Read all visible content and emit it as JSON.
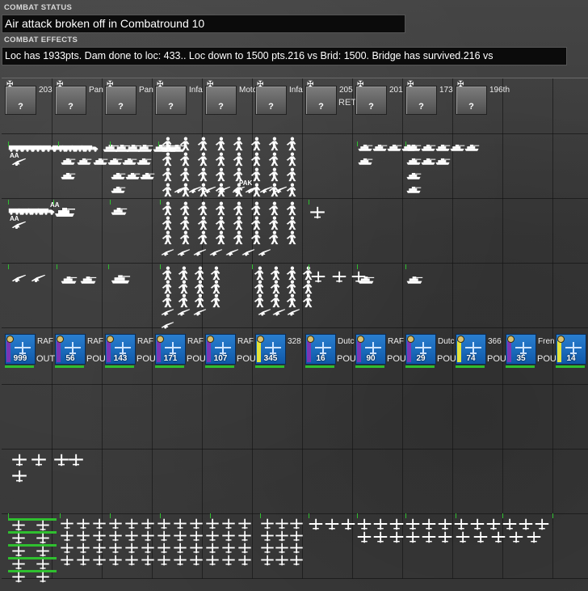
{
  "combat_status": {
    "label": "COMBAT STATUS",
    "text": "Air attack broken off in Combatround  10"
  },
  "combat_effects": {
    "label": "COMBAT EFFECTS",
    "text": "Loc has  1933pts. Dam done to loc: 433.. Loc down to 1500 pts.216 vs Brid: 1500. Bridge has survived.216 vs"
  },
  "defender_units": [
    {
      "name": "203",
      "value": "?"
    },
    {
      "name": "Pan",
      "value": "?"
    },
    {
      "name": "Pan",
      "value": "?"
    },
    {
      "name": "Infa",
      "value": "?"
    },
    {
      "name": "Moto",
      "value": "?"
    },
    {
      "name": "Infa",
      "value": "?"
    },
    {
      "name": "205",
      "value": "?",
      "status": "RET"
    },
    {
      "name": "201",
      "value": "?"
    },
    {
      "name": "173",
      "value": "?"
    },
    {
      "name": "196th",
      "value": "?"
    }
  ],
  "air_units": [
    {
      "name": "RAF",
      "value": "999",
      "status": "OUT",
      "stripe": "purple"
    },
    {
      "name": "RAF",
      "value": "56",
      "status": "POU",
      "stripe": "purple"
    },
    {
      "name": "RAF",
      "value": "143",
      "status": "POU",
      "stripe": "purple"
    },
    {
      "name": "RAF",
      "value": "171",
      "status": "POU",
      "stripe": "purple"
    },
    {
      "name": "RAF",
      "value": "107",
      "status": "POU",
      "stripe": "purple"
    },
    {
      "name": "328",
      "value": "345",
      "status": "",
      "stripe": "yellow"
    },
    {
      "name": "Dutc",
      "value": "16",
      "status": "POU",
      "stripe": "purple"
    },
    {
      "name": "RAF",
      "value": "90",
      "status": "POU",
      "stripe": "purple"
    },
    {
      "name": "Dutc",
      "value": "29",
      "status": "POU",
      "stripe": "purple"
    },
    {
      "name": "366",
      "value": "74",
      "status": "POU",
      "stripe": "yellow"
    },
    {
      "name": "Fren",
      "value": "35",
      "status": "POU",
      "stripe": "purple"
    },
    {
      "name": "",
      "value": "14",
      "status": "",
      "stripe": "yellow"
    }
  ],
  "element_labels": {
    "aa_1": "AA",
    "aa_2": "AA",
    "aa_3": "AA",
    "pak": "PAK"
  },
  "icons": {
    "unit_badge": "cross-icon",
    "soldier": "infantry-icon",
    "tank": "tank-icon",
    "truck": "truck-icon",
    "gun": "artillery-icon",
    "plane": "aircraft-icon"
  },
  "colors": {
    "air_unit_bg": "#1a6cc0",
    "stripe_purple": "#7a35b5",
    "stripe_yellow": "#e4e23a",
    "health_green": "#2fbf2f",
    "textbox_bg": "#0b0b0b"
  }
}
